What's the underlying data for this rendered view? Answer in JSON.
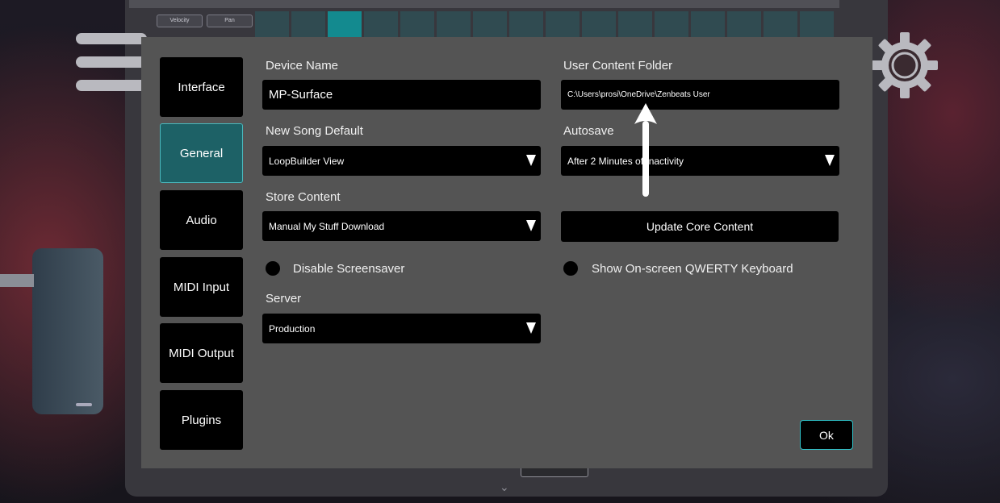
{
  "background": {
    "pad_buttons": [
      "Velocity",
      "Pan"
    ],
    "pads": [
      false,
      false,
      true,
      false,
      false,
      false,
      false,
      false,
      false,
      false,
      false,
      false,
      false,
      false,
      false,
      false
    ]
  },
  "sidebar": {
    "tabs": [
      {
        "label": "Interface",
        "active": false
      },
      {
        "label": "General",
        "active": true
      },
      {
        "label": "Audio",
        "active": false
      },
      {
        "label": "MIDI Input",
        "active": false
      },
      {
        "label": "MIDI Output",
        "active": false
      },
      {
        "label": "Plugins",
        "active": false
      }
    ]
  },
  "general": {
    "device_name": {
      "label": "Device Name",
      "value": "MP-Surface"
    },
    "new_song_default": {
      "label": "New Song Default",
      "value": "LoopBuilder View"
    },
    "store_content": {
      "label": "Store Content",
      "value": "Manual My Stuff Download"
    },
    "disable_screensaver": {
      "label": "Disable Screensaver",
      "checked": false
    },
    "server": {
      "label": "Server",
      "value": "Production"
    },
    "user_content_folder": {
      "label": "User Content Folder",
      "value": "C:\\Users\\prosi\\OneDrive\\Zenbeats User"
    },
    "autosave": {
      "label": "Autosave",
      "value": "After 2 Minutes of Inactivity"
    },
    "update_core_content": {
      "label": "Update Core Content"
    },
    "show_qwerty": {
      "label": "Show On-screen QWERTY Keyboard",
      "checked": false
    }
  },
  "ok_label": "Ok",
  "colors": {
    "dialog_bg": "#545454",
    "active_tab": "#1d6166",
    "accent": "#2fc4cb"
  }
}
